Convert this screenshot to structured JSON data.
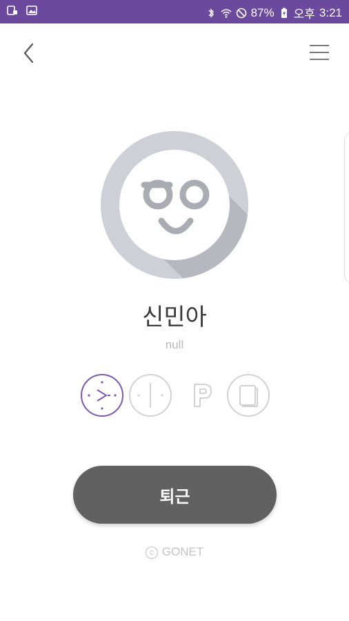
{
  "status_bar": {
    "battery": "87%",
    "period": "오후",
    "time": "3:21",
    "background": "#6b4a9e"
  },
  "header": {
    "back_icon": "chevron-left-icon",
    "menu_icon": "hamburger-menu-icon"
  },
  "profile": {
    "name": "신민아",
    "subtitle": "null"
  },
  "action_icons": [
    {
      "name": "clock-in-icon",
      "active": true
    },
    {
      "name": "clock-center-icon",
      "active": false
    },
    {
      "name": "parking-icon",
      "active": false
    },
    {
      "name": "document-icon",
      "active": false
    }
  ],
  "primary_button": {
    "label": "퇴근"
  },
  "footer": {
    "copyright_symbol": "c",
    "brand": "GONET"
  },
  "colors": {
    "accent": "#7a57b0",
    "button": "#616161",
    "avatar_ring": "#c8cbd1",
    "avatar_face": "#a9acb3"
  }
}
